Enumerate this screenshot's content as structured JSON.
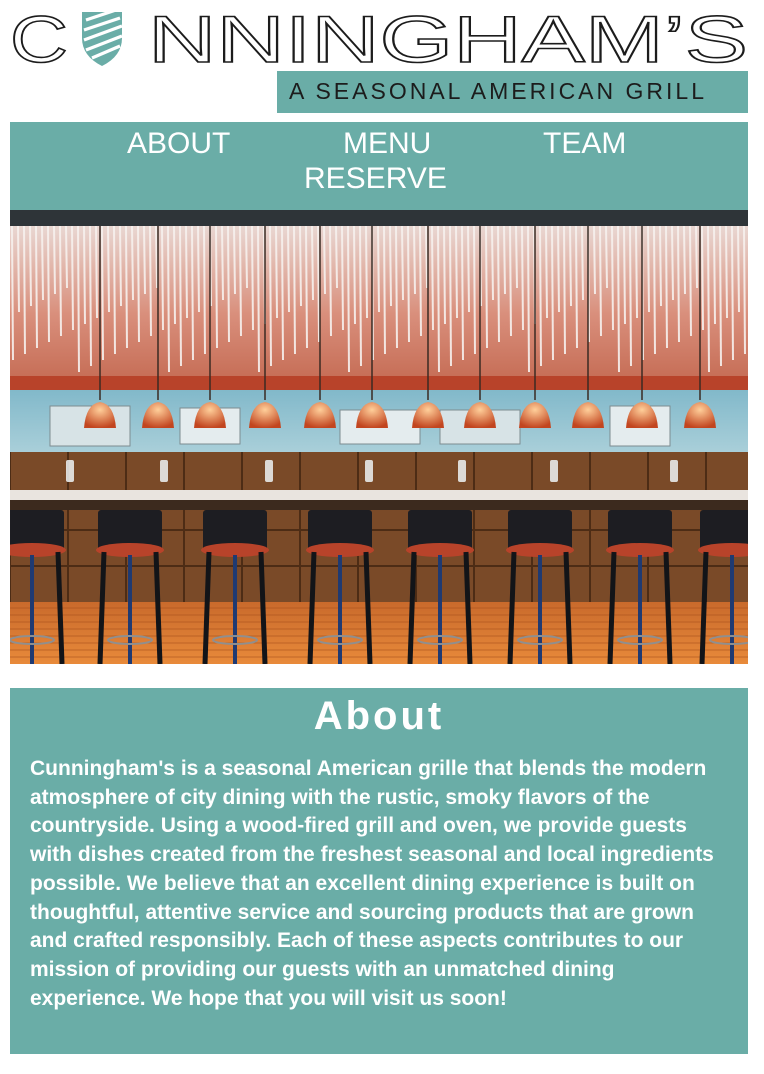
{
  "brand": {
    "name": "CUNNINGHAM'S",
    "name_left": "C",
    "name_right": "NNINGHAM’S",
    "tagline": "A SEASONAL AMERICAN GRILL",
    "logo_icon": "striped-shield-icon"
  },
  "nav": {
    "items": [
      {
        "label": "ABOUT"
      },
      {
        "label": "MENU"
      },
      {
        "label": "TEAM"
      },
      {
        "label": "RESERVE"
      }
    ]
  },
  "hero": {
    "subject": "restaurant-bar-interior-photo"
  },
  "about": {
    "title": "About",
    "body": "Cunningham's is a seasonal American grille that blends the modern atmosphere of city dining with the rustic, smoky flavors of the countryside. Using a wood-fired grill and oven, we provide guests with dishes created from the freshest seasonal and local ingredients possible. We believe that an excellent dining experience is built on thoughtful, attentive service and sourcing products that are grown and crafted responsibly. Each of these aspects contributes to our mission of providing our guests with an unmatched dining experience. We hope that you will visit us soon!"
  },
  "colors": {
    "teal": "#6aada7",
    "text_dark": "#1c1c1c",
    "white": "#ffffff"
  }
}
